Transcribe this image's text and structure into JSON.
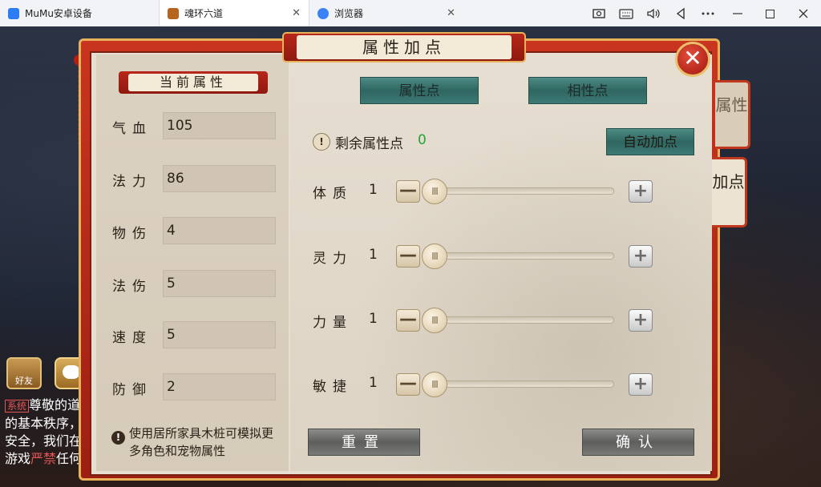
{
  "browser": {
    "tabs": [
      {
        "label": "MuMu安卓设备",
        "active": false,
        "icon": "mumu-icon",
        "icon_color": "#2d7cf6"
      },
      {
        "label": "魂环六道",
        "active": true,
        "icon": "game-icon",
        "icon_color": "#b5651d"
      },
      {
        "label": "浏览器",
        "active": false,
        "icon": "browser-icon",
        "icon_color": "#3b82f6"
      }
    ],
    "close_glyph": "✕",
    "toolbar_icons": [
      "screenshot-icon",
      "keyboard-icon",
      "volume-icon",
      "back-icon",
      "more-icon",
      "minimize-icon",
      "maximize-icon",
      "close-icon"
    ]
  },
  "dialog": {
    "title": "属性加点",
    "close_glyph": "✕",
    "left": {
      "title": "当前属性",
      "stats": [
        {
          "label": "气血",
          "value": "105"
        },
        {
          "label": "法力",
          "value": "86"
        },
        {
          "label": "物伤",
          "value": "4"
        },
        {
          "label": "法伤",
          "value": "5"
        },
        {
          "label": "速度",
          "value": "5"
        },
        {
          "label": "防御",
          "value": "2"
        }
      ],
      "tip": "使用居所家具木桩可模拟更多角色和宠物属性"
    },
    "right": {
      "tabs": [
        "属性点",
        "相性点"
      ],
      "remaining_label": "剩余属性点",
      "remaining_value": "0",
      "auto_button": "自动加点",
      "sliders": [
        {
          "label": "体质",
          "value": "1",
          "fill": 0
        },
        {
          "label": "灵力",
          "value": "1",
          "fill": 0
        },
        {
          "label": "力量",
          "value": "1",
          "fill": 0
        },
        {
          "label": "敏捷",
          "value": "1",
          "fill": 0
        }
      ],
      "reset_button": "重置",
      "confirm_button": "确认"
    },
    "side_tabs": [
      {
        "label": "属性",
        "active": false
      },
      {
        "label": "加点",
        "active": true
      }
    ]
  },
  "game_hud": {
    "friend_label": "好友",
    "chat_lines": [
      {
        "system_tag": "系统",
        "text": "尊敬的道"
      },
      {
        "text": "的基本秩序，"
      },
      {
        "text": "安全，我们在"
      },
      {
        "text": "游戏",
        "highlight": "严禁",
        "tail": "任何"
      }
    ]
  },
  "colors": {
    "frame_red": "#c0391f",
    "frame_gold": "#e8b25a",
    "teal_button": "#3c7a73",
    "gray_button": "#6e6e6c",
    "remaining_green": "#21a43a"
  }
}
